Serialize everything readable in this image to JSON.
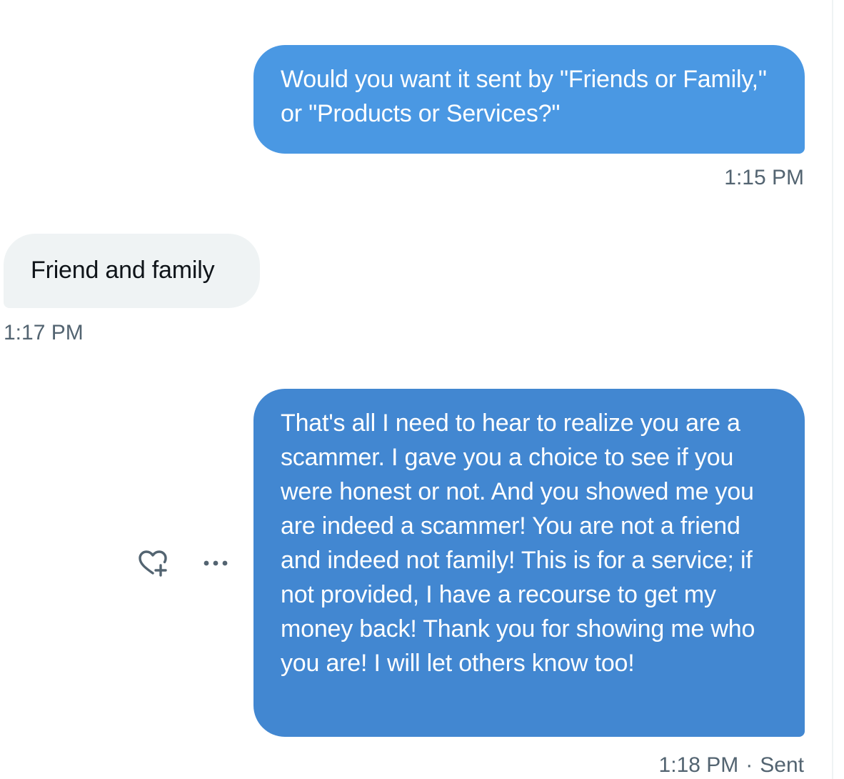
{
  "conversation": {
    "messages": [
      {
        "direction": "sent",
        "text": "Would you want it sent by \"Friends or Family,\" or \"Products or Services?\"",
        "time": "1:15 PM"
      },
      {
        "direction": "received",
        "text": "Friend and family",
        "time": "1:17 PM"
      },
      {
        "direction": "sent",
        "text": "That's all I need to hear to realize you are a scammer. I gave you a choice to see if you were honest or not. And you showed me you are indeed a scammer! You are not a friend and indeed not family! This is for a service; if not provided, I have a recourse to get my money back! Thank you for showing me who you are! I will let others know too!",
        "time": "1:18 PM",
        "separator": "·",
        "status": "Sent"
      }
    ],
    "hover_actions": {
      "react_icon": "heart-plus-icon",
      "more_icon": "more-dots-icon"
    }
  },
  "colors": {
    "sent_bubble": "#4a98e3",
    "sent_bubble_hover": "#4287d1",
    "received_bubble": "#eff3f4",
    "meta_text": "#536471",
    "icon": "#536471"
  }
}
